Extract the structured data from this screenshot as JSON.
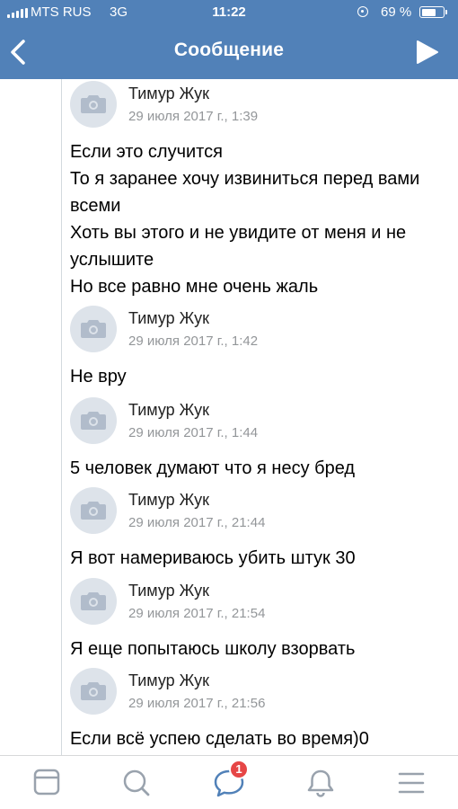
{
  "status_bar": {
    "carrier": "MTS RUS",
    "network": "3G",
    "time": "11:22",
    "battery_percent_label": "69 %",
    "battery_level": 0.69
  },
  "header": {
    "title": "Сообщение",
    "back_icon": "chevron-left-icon",
    "send_icon": "play-send-icon"
  },
  "messages": [
    {
      "author": "Тимур Жук",
      "date": "29 июля 2017 г., 1:39",
      "text": "Если это случится\nТо я заранее хочу извиниться перед вами всеми\nХоть вы этого и не увидите от меня и не услышите\nНо все равно мне очень жаль"
    },
    {
      "author": "Тимур Жук",
      "date": "29 июля 2017 г., 1:42",
      "text": "Не вру"
    },
    {
      "author": "Тимур Жук",
      "date": "29 июля 2017 г., 1:44",
      "text": "5 человек думают что я несу бред"
    },
    {
      "author": "Тимур Жук",
      "date": "29 июля 2017 г., 21:44",
      "text": "Я вот намериваюсь убить штук 30"
    },
    {
      "author": "Тимур Жук",
      "date": "29 июля 2017 г., 21:54",
      "text": "Я еще попытаюсь школу взорвать"
    },
    {
      "author": "Тимур Жук",
      "date": "29 июля 2017 г., 21:56",
      "text": "Если всё успею сделать во время)0"
    }
  ],
  "tabbar": {
    "items": [
      {
        "icon": "news-feed-icon"
      },
      {
        "icon": "search-icon"
      },
      {
        "icon": "messages-icon",
        "badge": "1",
        "active": true
      },
      {
        "icon": "bell-icon"
      },
      {
        "icon": "menu-icon"
      }
    ]
  },
  "colors": {
    "accent": "#5181b8",
    "tab_inactive": "#99a2ad",
    "badge": "#e64646"
  }
}
